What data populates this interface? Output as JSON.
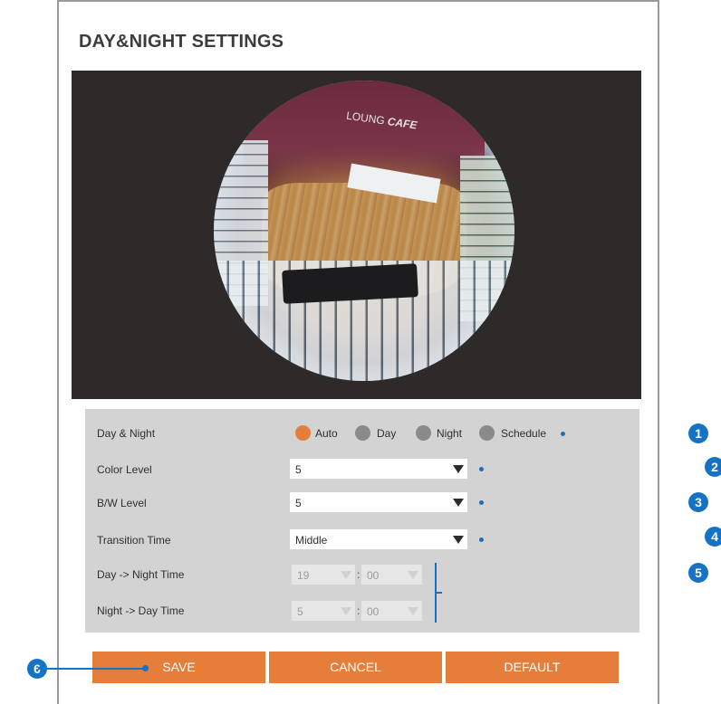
{
  "title": "DAY&NIGHT SETTINGS",
  "video": {
    "sign_text_a": "LOUNG",
    "sign_text_b": "CAFE"
  },
  "settings": {
    "day_night": {
      "label": "Day & Night",
      "options": [
        {
          "label": "Auto",
          "selected": true
        },
        {
          "label": "Day",
          "selected": false
        },
        {
          "label": "Night",
          "selected": false
        },
        {
          "label": "Schedule",
          "selected": false
        }
      ]
    },
    "color_level": {
      "label": "Color Level",
      "value": "5"
    },
    "bw_level": {
      "label": "B/W Level",
      "value": "5"
    },
    "transition_time": {
      "label": "Transition Time",
      "value": "Middle"
    },
    "day_to_night": {
      "label": "Day -> Night Time",
      "hour": "19",
      "minute": "00"
    },
    "night_to_day": {
      "label": "Night -> Day Time",
      "hour": "5",
      "minute": "00"
    },
    "time_separator": ":"
  },
  "buttons": {
    "save": "SAVE",
    "cancel": "CANCEL",
    "default": "DEFAULT"
  },
  "callouts": [
    "1",
    "2",
    "3",
    "4",
    "5",
    "6"
  ],
  "colors": {
    "accent": "#e67e3b",
    "callout": "#1673c4",
    "panel": "#d3d3d3",
    "radio_off": "#8a8a8a"
  }
}
